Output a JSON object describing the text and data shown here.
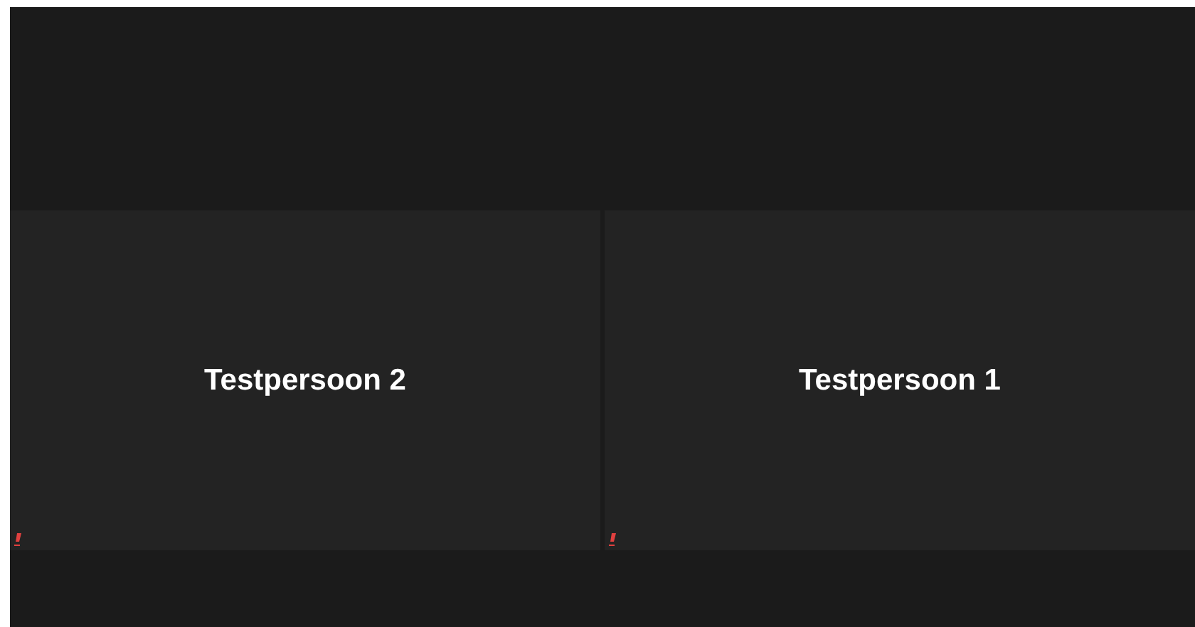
{
  "participants": [
    {
      "name": "Testpersoon 2",
      "muted": true
    },
    {
      "name": "Testpersoon 1",
      "muted": true
    }
  ]
}
